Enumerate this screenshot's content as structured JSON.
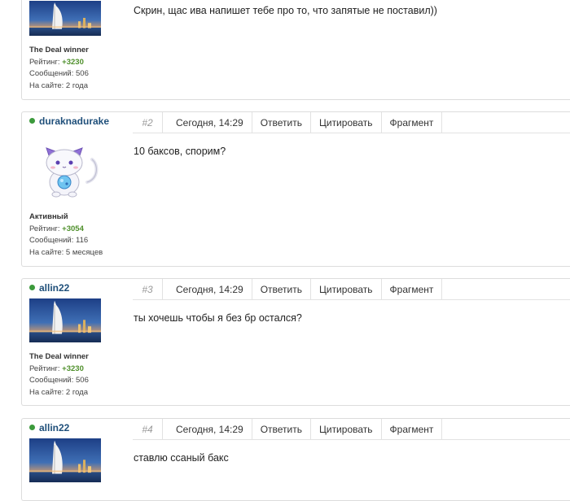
{
  "posts": [
    {
      "text": "Скрин, щас ива напишет тебе про то, что запятые не поставил))",
      "author": {
        "rank": "The Deal winner",
        "rating_label": "Рейтинг:",
        "rating": "+3230",
        "messages": "Сообщений: 506",
        "on_site": "На сайте: 2 года",
        "avatar": "burj-al-arab-avatar"
      }
    },
    {
      "number": "#2",
      "date": "Сегодня, 14:29",
      "reply": "Ответить",
      "quote": "Цитировать",
      "fragment": "Фрагмент",
      "text": "10 баксов, спорим?",
      "author": {
        "name": "duraknadurake",
        "rank": "Активный",
        "rating_label": "Рейтинг:",
        "rating": "+3054",
        "messages": "Сообщений: 116",
        "on_site": "На сайте: 5 месяцев",
        "avatar": "cat-avatar"
      }
    },
    {
      "number": "#3",
      "date": "Сегодня, 14:29",
      "reply": "Ответить",
      "quote": "Цитировать",
      "fragment": "Фрагмент",
      "text": "ты хочешь чтобы я без бр остался?",
      "author": {
        "name": "allin22",
        "rank": "The Deal winner",
        "rating_label": "Рейтинг:",
        "rating": "+3230",
        "messages": "Сообщений: 506",
        "on_site": "На сайте: 2 года",
        "avatar": "burj-al-arab-avatar"
      }
    },
    {
      "number": "#4",
      "date": "Сегодня, 14:29",
      "reply": "Ответить",
      "quote": "Цитировать",
      "fragment": "Фрагмент",
      "text": "ставлю ссаный бакс",
      "author": {
        "name": "allin22",
        "avatar": "burj-al-arab-avatar"
      }
    }
  ],
  "colors": {
    "online": "#3c9a3c",
    "username": "#1f4f7a",
    "rating": "#4e8f2a"
  }
}
